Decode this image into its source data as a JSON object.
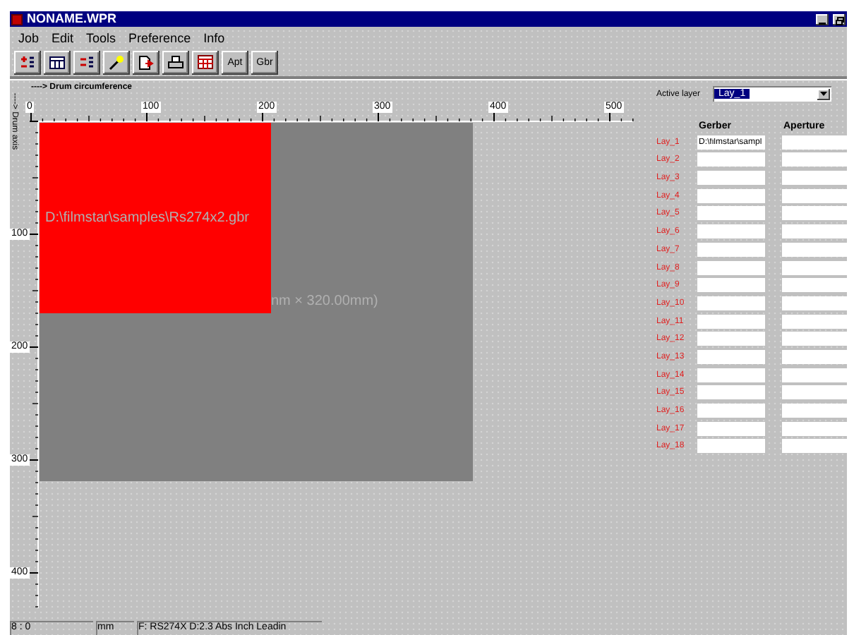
{
  "window": {
    "title": "NONAME.WPR"
  },
  "menu": [
    "Job",
    "Edit",
    "Tools",
    "Preference",
    "Info"
  ],
  "toolbar": [
    {
      "kind": "icon"
    },
    {
      "kind": "icon"
    },
    {
      "kind": "icon"
    },
    {
      "kind": "icon"
    },
    {
      "kind": "icon"
    },
    {
      "kind": "icon"
    },
    {
      "kind": "icon"
    },
    {
      "kind": "text",
      "label": "Apt"
    },
    {
      "kind": "text",
      "label": "Gbr"
    }
  ],
  "workspace": {
    "x_axis_label": "----> Drum circumference",
    "y_axis_label": "----> Drum axis",
    "x_ruler": [
      "0",
      "100",
      "200",
      "300",
      "400",
      "500"
    ],
    "y_ruler": [
      "100",
      "200",
      "300",
      "400"
    ],
    "file_label": "D:\\filmstar\\samples\\Rs274x2.gbr",
    "size_label": "nm × 320.00mm)"
  },
  "layers_panel": {
    "active_layer_label": "Active layer",
    "active_layer": "Lay_1",
    "columns": [
      "Gerber",
      "Aperture"
    ],
    "rows": [
      {
        "name": "Lay_1",
        "gerber": "D:\\filmstar\\sampl"
      },
      {
        "name": "Lay_2"
      },
      {
        "name": "Lay_3"
      },
      {
        "name": "Lay_4"
      },
      {
        "name": "Lay_5"
      },
      {
        "name": "Lay_6"
      },
      {
        "name": "Lay_7"
      },
      {
        "name": "Lay_8"
      },
      {
        "name": "Lay_9"
      },
      {
        "name": "Lay_10"
      },
      {
        "name": "Lay_11"
      },
      {
        "name": "Lay_12"
      },
      {
        "name": "Lay_13"
      },
      {
        "name": "Lay_14"
      },
      {
        "name": "Lay_15"
      },
      {
        "name": "Lay_16"
      },
      {
        "name": "Lay_17"
      },
      {
        "name": "Lay_18"
      }
    ]
  },
  "status_bar": [
    "8 : 0",
    "mm",
    "F: RS274X D:2.3 Abs Inch Leadin"
  ]
}
